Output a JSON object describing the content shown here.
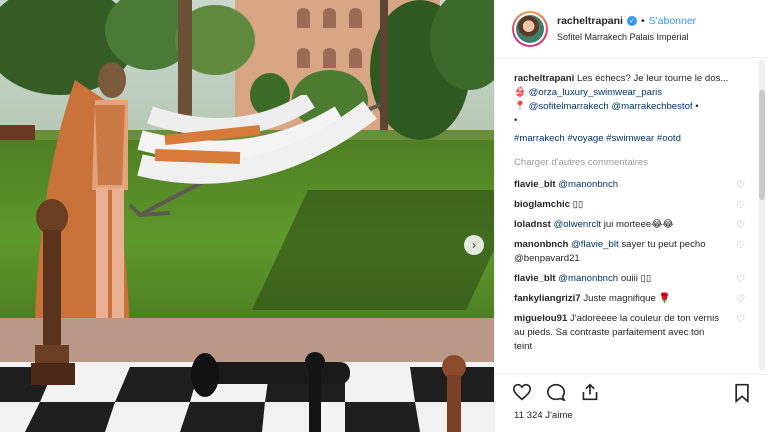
{
  "post": {
    "username": "racheltrapani",
    "follow_label": "S'abonner",
    "location": "Sofitel Marrakech Palais Impérial",
    "verified_glyph": "✓"
  },
  "caption": {
    "username": "racheltrapani",
    "text": "Les échecs? Je leur tourne le dos...",
    "line2_prefix": "👙",
    "line2_mention": "@orza_luxury_swimwear_paris",
    "line3_prefix": "📍",
    "line3_mentions": "@sofitelmarrakech @marrakechbestof",
    "line3_suffix": "•",
    "bullet": "•",
    "hashtags": "#marrakech #voyage #swimwear #ootd"
  },
  "load_more_label": "Charger d'autres commentaires",
  "comments": [
    {
      "user": "flavie_blt",
      "mention": "@manonbnch",
      "text": ""
    },
    {
      "user": "bioglamchic",
      "mention": "",
      "text": "▯▯"
    },
    {
      "user": "loladnst",
      "mention": "@olwenrclt",
      "text": "jui morteee😂😂"
    },
    {
      "user": "manonbnch",
      "mention": "@flavie_blt",
      "text": "sayer tu peut pecho @benpavard21"
    },
    {
      "user": "flavie_blt",
      "mention": "@manonbnch",
      "text": "ouiii ▯▯"
    },
    {
      "user": "fankyliangrizi7",
      "mention": "",
      "text": "Juste magnifique 🌹"
    },
    {
      "user": "miguelou91",
      "mention": "",
      "text": "J'adoreeee la couleur de ton vernis au pieds. Sa contraste parfaitement avec ton teint"
    }
  ],
  "actions": {
    "like_icon": "heart-icon",
    "comment_icon": "comment-icon",
    "share_icon": "share-icon",
    "save_icon": "bookmark-icon"
  },
  "likes_label": "11 324 J'aime",
  "carousel_next_glyph": "›",
  "heart_glyph": "♡",
  "colors": {
    "link": "#003569",
    "follow": "#3897f0",
    "muted": "#999999"
  }
}
